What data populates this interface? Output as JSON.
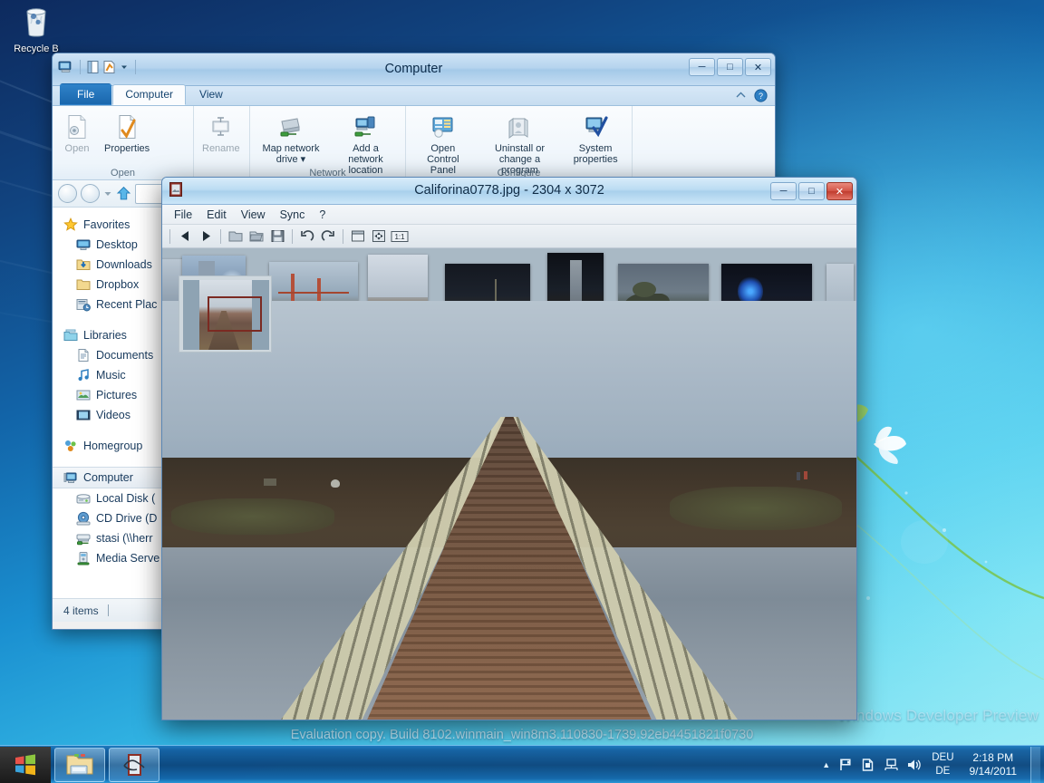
{
  "desktop": {
    "recycle_bin_label": "Recycle B",
    "watermark": "Windows Developer Preview",
    "eval_copy": "Evaluation copy. Build 8102.winmain_win8m3.110830-1739.92eb4451821f0730"
  },
  "explorer": {
    "title": "Computer",
    "quick_access": [
      "computer-icon",
      "pane-icon",
      "properties-icon",
      "dropdown-arrow"
    ],
    "window_buttons": {
      "minimize": "─",
      "maximize": "□",
      "close": "✕"
    },
    "tabs": [
      {
        "label": "File",
        "kind": "file"
      },
      {
        "label": "Computer",
        "kind": "active"
      },
      {
        "label": "View",
        "kind": "normal"
      }
    ],
    "tab_right_icons": [
      "minimize-ribbon-icon",
      "help-icon"
    ],
    "ribbon_groups": [
      {
        "label": "Open",
        "items": [
          {
            "label": "Open",
            "icon": "open-icon",
            "disabled": true
          },
          {
            "label": "Properties",
            "icon": "properties-icon",
            "disabled": false
          }
        ]
      },
      {
        "label": "",
        "items": [
          {
            "label": "Rename",
            "icon": "rename-icon",
            "disabled": true
          }
        ]
      },
      {
        "label": "Network",
        "items": [
          {
            "label": "Map network drive ▾",
            "icon": "map-network-drive-icon",
            "disabled": false
          },
          {
            "label": "Add a network location",
            "icon": "add-network-location-icon",
            "disabled": false
          }
        ]
      },
      {
        "label": "Configure",
        "items": [
          {
            "label": "Open Control Panel",
            "icon": "control-panel-icon",
            "disabled": false
          },
          {
            "label": "Uninstall or change a program",
            "icon": "uninstall-program-icon",
            "disabled": false
          },
          {
            "label": "System properties",
            "icon": "system-properties-icon",
            "disabled": false
          }
        ]
      }
    ],
    "nav_pane": [
      {
        "label": "Favorites",
        "icon": "star-icon",
        "level": 0,
        "selected": false
      },
      {
        "label": "Desktop",
        "icon": "desktop-icon",
        "level": 1,
        "selected": false
      },
      {
        "label": "Downloads",
        "icon": "downloads-folder-icon",
        "level": 1,
        "selected": false
      },
      {
        "label": "Dropbox",
        "icon": "folder-icon",
        "level": 1,
        "selected": false
      },
      {
        "label": "Recent Plac",
        "icon": "recent-places-icon",
        "level": 1,
        "selected": false
      },
      {
        "label": "GAP",
        "icon": "",
        "level": -1,
        "selected": false
      },
      {
        "label": "Libraries",
        "icon": "libraries-icon",
        "level": 0,
        "selected": false
      },
      {
        "label": "Documents",
        "icon": "documents-icon",
        "level": 1,
        "selected": false
      },
      {
        "label": "Music",
        "icon": "music-icon",
        "level": 1,
        "selected": false
      },
      {
        "label": "Pictures",
        "icon": "pictures-icon",
        "level": 1,
        "selected": false
      },
      {
        "label": "Videos",
        "icon": "videos-icon",
        "level": 1,
        "selected": false
      },
      {
        "label": "GAP",
        "icon": "",
        "level": -1,
        "selected": false
      },
      {
        "label": "Homegroup",
        "icon": "homegroup-icon",
        "level": 0,
        "selected": false
      },
      {
        "label": "GAP",
        "icon": "",
        "level": -1,
        "selected": false
      },
      {
        "label": "Computer",
        "icon": "computer-icon",
        "level": 0,
        "selected": true
      },
      {
        "label": "Local Disk (",
        "icon": "local-disk-icon",
        "level": 1,
        "selected": false
      },
      {
        "label": "CD Drive (D",
        "icon": "cd-drive-icon",
        "level": 1,
        "selected": false
      },
      {
        "label": "stasi (\\\\herr",
        "icon": "network-drive-icon",
        "level": 1,
        "selected": false
      },
      {
        "label": "Media Serve",
        "icon": "media-server-icon",
        "level": 1,
        "selected": false
      }
    ],
    "status_text": "4 items"
  },
  "viewer": {
    "title": "Califorina0778.jpg - 2304 x 3072",
    "file_name": "Califorina0778.jpg",
    "dimensions": "2304 x 3072",
    "window_buttons": {
      "minimize": "─",
      "maximize": "□",
      "close": "✕"
    },
    "menus": [
      "File",
      "Edit",
      "View",
      "Sync",
      "?"
    ],
    "toolbar_icons": [
      "previous-image-icon",
      "next-image-icon",
      "separator",
      "open-folder-icon",
      "open-folder-alt-icon",
      "save-icon",
      "separator",
      "rotate-left-icon",
      "rotate-right-icon",
      "separator",
      "fit-window-icon",
      "fullscreen-icon",
      "actual-size-icon"
    ],
    "actual_size_label": "1:1",
    "thumbnails": [
      {
        "name": "partial-left-thumb"
      },
      {
        "name": "skyscraper-thumb"
      },
      {
        "name": "golden-gate-bridge-thumb"
      },
      {
        "name": "boardwalk-thumb"
      },
      {
        "name": "city-lights-thumb"
      },
      {
        "name": "night-tower-thumb"
      },
      {
        "name": "coast-cliff-thumb"
      },
      {
        "name": "ferris-wheel-thumb"
      },
      {
        "name": "partial-right-thumb"
      }
    ]
  },
  "taskbar": {
    "start_label": "start-orb",
    "items": [
      {
        "name": "file-explorer",
        "icon": "folder-icon"
      },
      {
        "name": "image-viewer",
        "icon": "image-viewer-icon"
      }
    ],
    "tray": {
      "show_hidden_label": "▲",
      "icons": [
        "action-center-flag-icon",
        "network-share-icon",
        "network-icon",
        "volume-icon"
      ],
      "keyboard_layout_line1": "DEU",
      "keyboard_layout_line2": "DE",
      "time": "2:18 PM",
      "date": "9/14/2011"
    }
  },
  "colors": {
    "accent_blue": "#1a67ad",
    "title_glass": "#b6d4ee",
    "close_red": "#c84a3f",
    "taskbar_blue": "#0c467d"
  }
}
